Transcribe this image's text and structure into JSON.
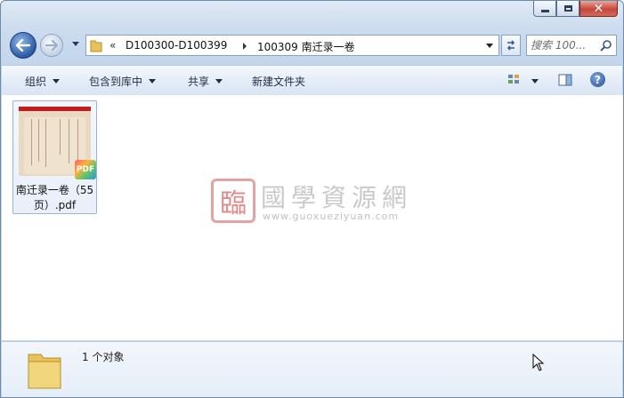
{
  "window": {
    "caption_buttons": {
      "minimize": "minimize-icon",
      "maximize": "maximize-icon",
      "close": "close-icon",
      "close_color": "#c8453a"
    }
  },
  "nav": {
    "chevron": "«",
    "breadcrumbs": [
      "D100300-D100399",
      "100309 南迁录一卷"
    ],
    "search_placeholder": "搜索 100..."
  },
  "toolbar": {
    "organize": "组织",
    "include_in_library": "包含到库中",
    "share": "共享",
    "new_folder": "新建文件夹"
  },
  "files": [
    {
      "name": "南迁录一卷（55页）.pdf",
      "badge": "PDF",
      "thumbnail_accent": "#c51a1a"
    }
  ],
  "watermark": {
    "logo_glyph": "臨",
    "title": "國學資源網",
    "url": "www.guoxueziyuan.com"
  },
  "details": {
    "count_text": "1 个对象"
  },
  "colors": {
    "accent": "#2a5aa5",
    "folder": "#e8c25a"
  }
}
